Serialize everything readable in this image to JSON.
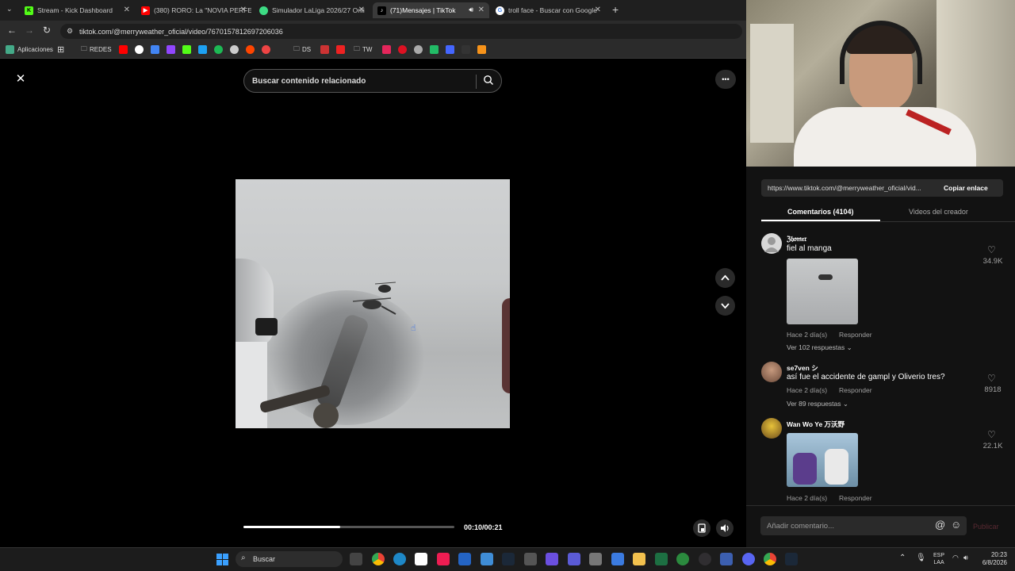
{
  "browser": {
    "tabs": [
      {
        "title": "Stream - Kick Dashboard",
        "color": "#53fc18"
      },
      {
        "title": "(380) RORO: La \"NOVIA PERFE",
        "color": "#ff0000"
      },
      {
        "title": "Simulador LaLiga 2026/27 Onli",
        "color": "#3ddc84"
      },
      {
        "title": "(71)Mensajes | TikTok",
        "color": "#ffffff"
      },
      {
        "title": "troll face - Buscar con Google",
        "color": "#4285f4"
      }
    ],
    "new_tab": "+",
    "url": "tiktok.com/@merryweather_oficial/video/7670157812697206036",
    "bookmarks": {
      "apps": "Aplicaciones",
      "folder1": "REDES",
      "folder2": "DS",
      "folder3": "TW"
    }
  },
  "player": {
    "close": "✕",
    "search_placeholder": "Buscar contenido relacionado",
    "more": "•••",
    "time": "00:10/00:21",
    "progress": 0.46
  },
  "panel": {
    "share_url": "https://www.tiktok.com/@merryweather_oficial/vid...",
    "copy_link": "Copiar enlace",
    "tab_comments": "Comentarios (4104)",
    "tab_creator": "Videos del creador",
    "comments": [
      {
        "name": "ℨ𝔥𝔬𝔪𝔢𝔯",
        "text": "fiel al manga",
        "time": "Hace 2 día(s)",
        "reply": "Responder",
        "likes": "34.9K",
        "replies": "Ver 102 respuestas"
      },
      {
        "name": "se7ven シ",
        "text": "así fue el accidente de gampl y Oliverio tres?",
        "time": "Hace 2 día(s)",
        "reply": "Responder",
        "likes": "8918",
        "replies": "Ver 89 respuestas"
      },
      {
        "name": "Wan Wo Ye 万沃野",
        "text": "",
        "time": "Hace 2 día(s)",
        "reply": "Responder",
        "likes": "22.1K",
        "replies": ""
      }
    ],
    "input_placeholder": "Añadir comentario...",
    "publish": "Publicar"
  },
  "taskbar": {
    "search": "Buscar",
    "lang1": "ESP",
    "lang2": "LAA",
    "time": "20:23",
    "date": "6/8/2026"
  }
}
